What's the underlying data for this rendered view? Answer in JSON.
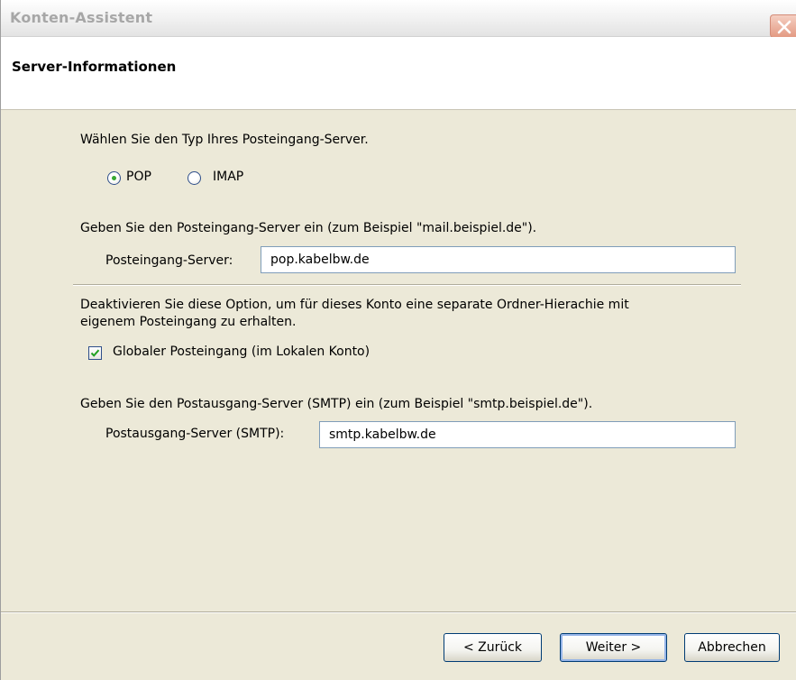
{
  "window": {
    "title": "Konten-Assistent"
  },
  "header": {
    "title": "Server-Informationen"
  },
  "incoming_type": {
    "prompt": "Wählen Sie den Typ Ihres Posteingang-Server.",
    "options": [
      {
        "label": "POP",
        "selected": true
      },
      {
        "label": "IMAP",
        "selected": false
      }
    ]
  },
  "incoming_server": {
    "prompt": "Geben Sie den Posteingang-Server ein (zum Beispiel \"mail.beispiel.de\").",
    "label": "Posteingang-Server:",
    "value": "pop.kabelbw.de"
  },
  "global_inbox": {
    "description_line1": "Deaktivieren Sie diese Option, um für dieses Konto eine separate Ordner-Hierachie mit",
    "description_line2": "eigenem Posteingang zu erhalten.",
    "label": "Globaler Posteingang (im Lokalen Konto)",
    "checked": true
  },
  "outgoing_server": {
    "prompt": "Geben Sie den Postausgang-Server (SMTP) ein (zum Beispiel \"smtp.beispiel.de\").",
    "label": "Postausgang-Server (SMTP):",
    "value": "smtp.kabelbw.de"
  },
  "buttons": {
    "back": "< Zurück",
    "next": "Weiter >",
    "cancel": "Abbrechen"
  },
  "icons": {
    "close": "close-icon",
    "radio_selected": "radio-selected-icon",
    "checkbox_check": "checkmark-icon"
  },
  "colors": {
    "window_bg": "#ece9d8",
    "radio_dot": "#38a832",
    "checkmark": "#21a121",
    "close_button": "#e39a83"
  }
}
